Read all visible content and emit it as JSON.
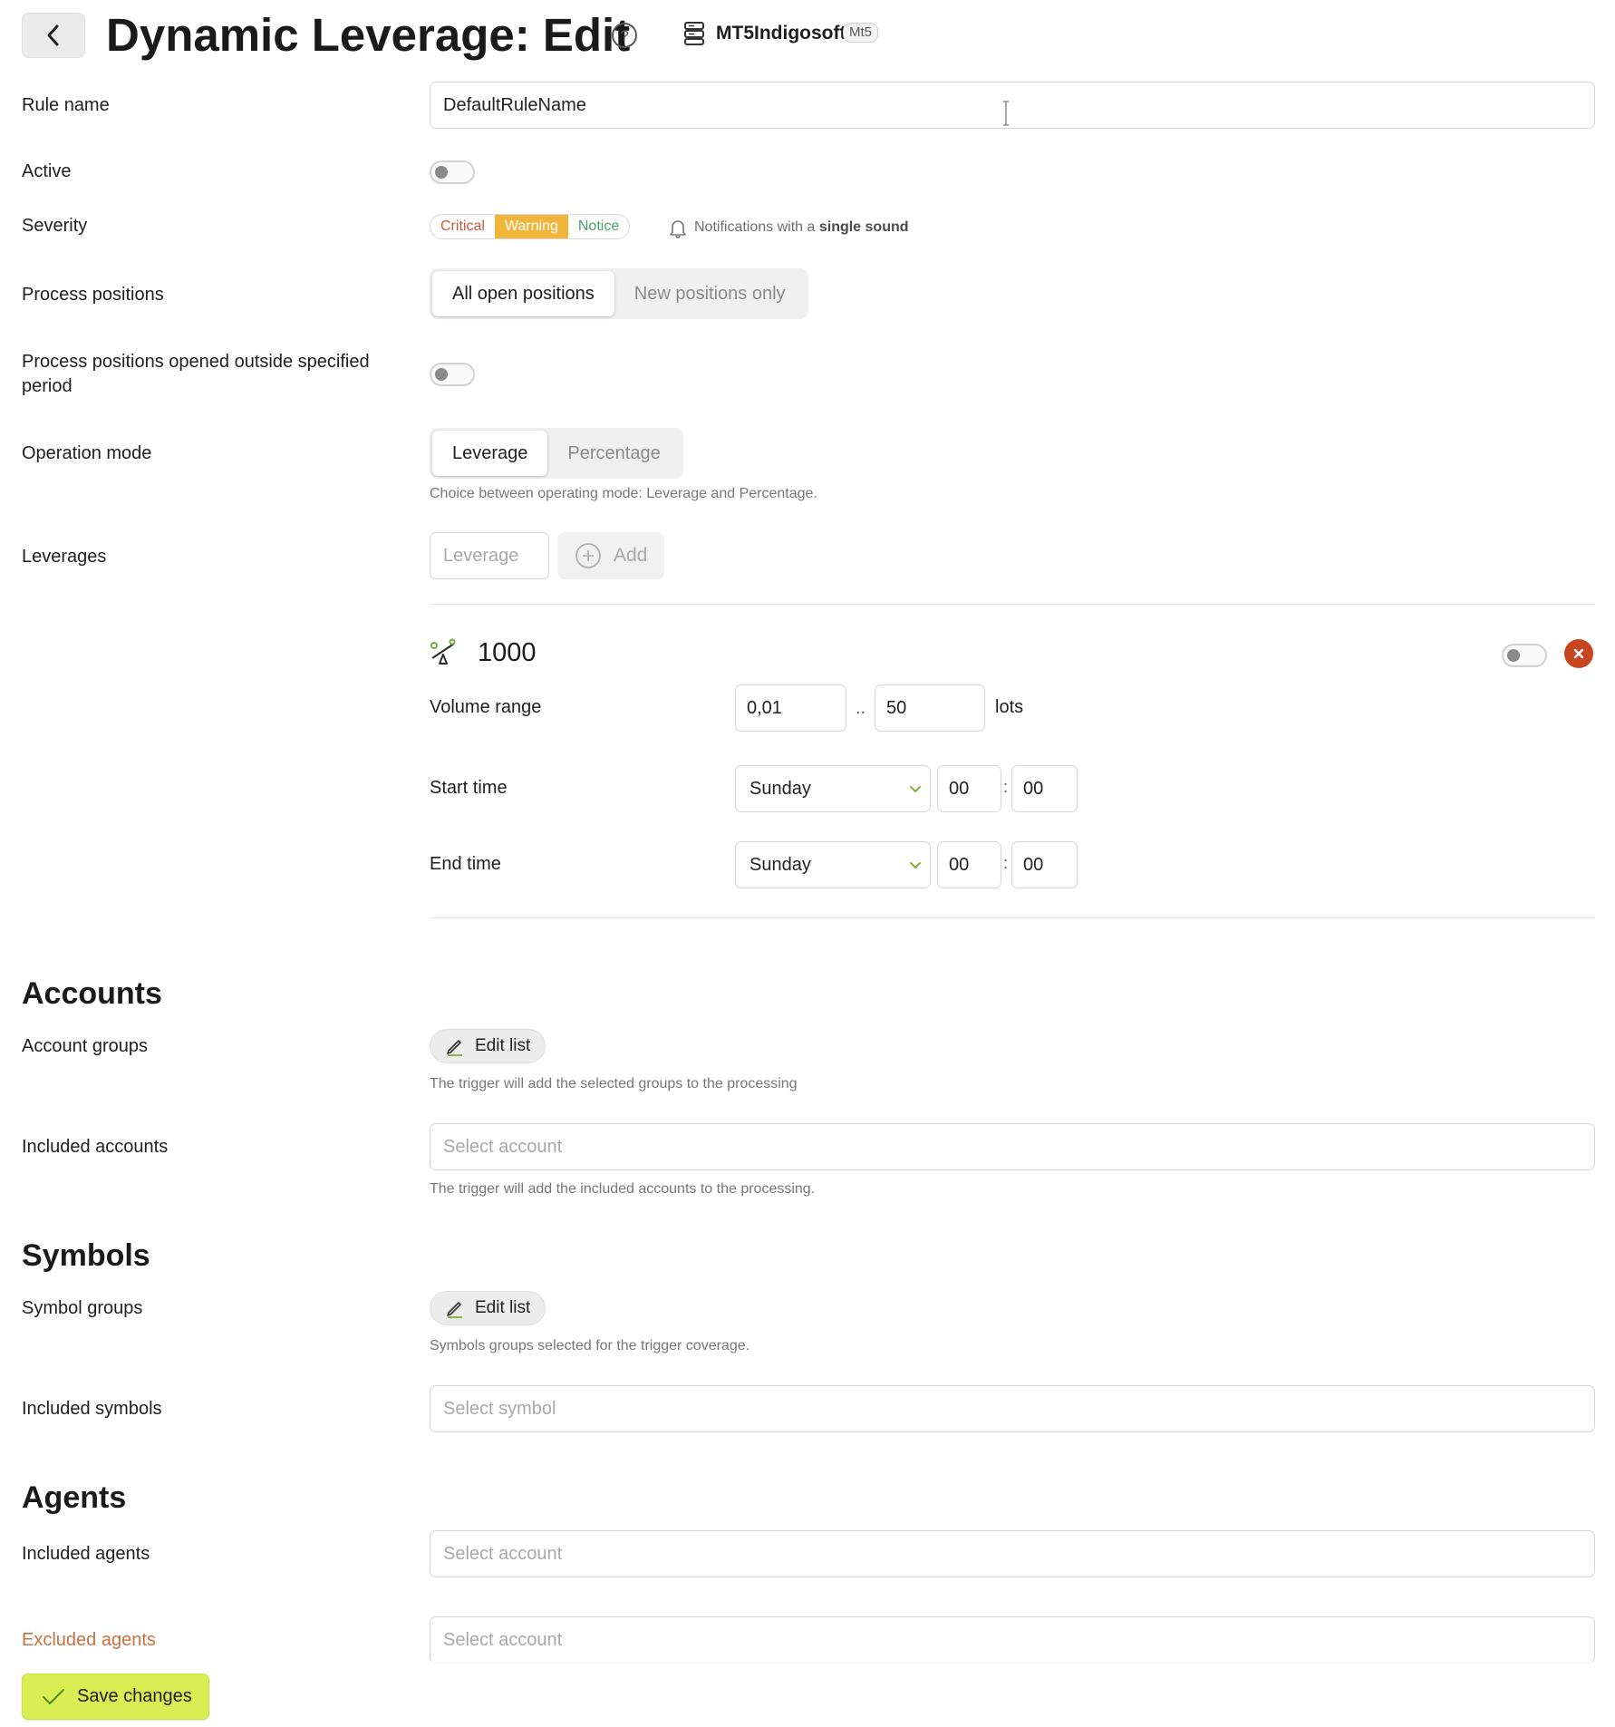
{
  "header": {
    "title": "Dynamic Leverage: Edit",
    "server_name": "MT5Indigosoft",
    "server_badge": "Mt5",
    "icons": {
      "back": "chevron-left-icon",
      "help": "question-circle-icon",
      "server": "server-icon"
    }
  },
  "rule_name": {
    "label": "Rule name",
    "value": "DefaultRuleName"
  },
  "active": {
    "label": "Active",
    "on": false
  },
  "severity": {
    "label": "Severity",
    "options": [
      "Critical",
      "Warning",
      "Notice"
    ],
    "selected": "Warning",
    "notification_prefix": "Notifications with a",
    "notification_emphasis": "single sound",
    "colors": {
      "critical": "#c65a3a",
      "warning": "#f1b53b",
      "notice": "#47a36a"
    }
  },
  "process_positions": {
    "label": "Process positions",
    "options": [
      "All open positions",
      "New positions only"
    ],
    "selected": "All open positions"
  },
  "outside_period": {
    "label": "Process positions opened outside specified period",
    "on": false
  },
  "operation_mode": {
    "label": "Operation mode",
    "options": [
      "Leverage",
      "Percentage"
    ],
    "selected": "Leverage",
    "hint": "Choice between operating mode: Leverage and Percentage."
  },
  "leverages": {
    "label": "Leverages",
    "input_placeholder": "Leverage",
    "add_label": "Add",
    "item": {
      "value": "1000",
      "enabled": false,
      "volume_range_label": "Volume range",
      "volume_min": "0,01",
      "range_separator": "..",
      "volume_max": "50",
      "volume_unit": "lots",
      "start_time_label": "Start time",
      "start_day": "Sunday",
      "start_hour": "00",
      "start_minute": "00",
      "end_time_label": "End time",
      "end_day": "Sunday",
      "end_hour": "00",
      "end_minute": "00",
      "time_separator": ":"
    }
  },
  "accounts": {
    "title": "Accounts",
    "groups_label": "Account groups",
    "edit_list_label": "Edit list",
    "groups_hint": "The trigger will add the selected groups to the processing",
    "included_label": "Included accounts",
    "included_placeholder": "Select account",
    "included_hint": "The trigger will add the included accounts to the processing."
  },
  "symbols": {
    "title": "Symbols",
    "groups_label": "Symbol groups",
    "edit_list_label": "Edit list",
    "groups_hint": "Symbols groups selected for the trigger coverage.",
    "included_label": "Included symbols",
    "included_placeholder": "Select symbol"
  },
  "agents": {
    "title": "Agents",
    "included_label": "Included agents",
    "included_placeholder": "Select account",
    "excluded_label": "Excluded agents",
    "excluded_placeholder": "Select account"
  },
  "footer": {
    "save_label": "Save changes",
    "accent": "#d9ee52"
  }
}
